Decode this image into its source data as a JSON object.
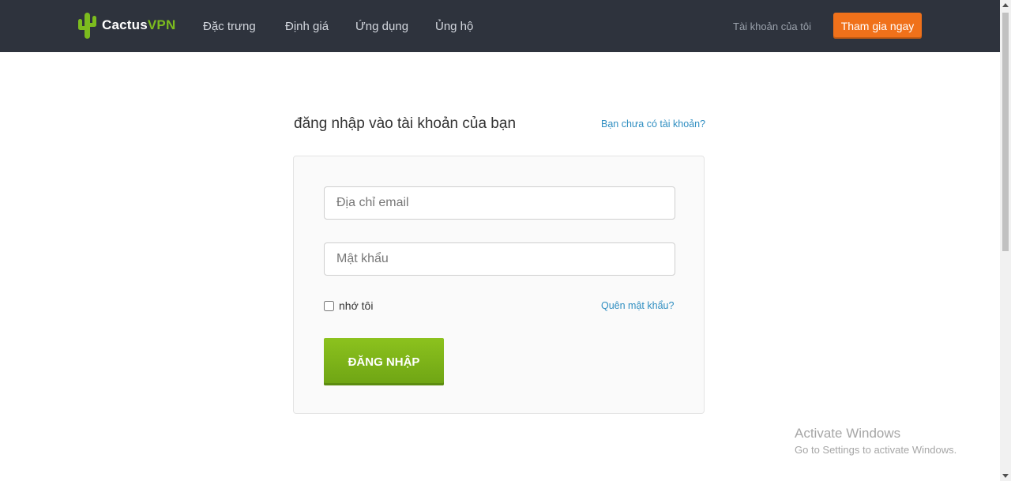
{
  "brand": {
    "name_white": "Cactus",
    "name_green": "VPN",
    "accent": "#7cbc1e"
  },
  "nav": {
    "items": [
      {
        "label": "Đặc trưng"
      },
      {
        "label": "Định giá"
      },
      {
        "label": "Ứng dụng"
      },
      {
        "label": "Ủng hộ"
      }
    ],
    "account_label": "Tài khoản của tôi",
    "join_label": "Tham gia ngay",
    "join_color": "#f0711a"
  },
  "login": {
    "title": "đăng nhập vào tài khoản của bạn",
    "no_account_link": "Bạn chưa có tài khoản?",
    "email_placeholder": "Địa chỉ email",
    "email_value": "",
    "password_placeholder": "Mật khẩu",
    "password_value": "",
    "remember_label": "nhớ tôi",
    "remember_checked": false,
    "forgot_link": "Quên mật khẩu?",
    "submit_label": "ĐĂNG NHẬP",
    "submit_color": "#7cb518"
  },
  "watermark": {
    "line1": "Activate Windows",
    "line2": "Go to Settings to activate Windows."
  }
}
